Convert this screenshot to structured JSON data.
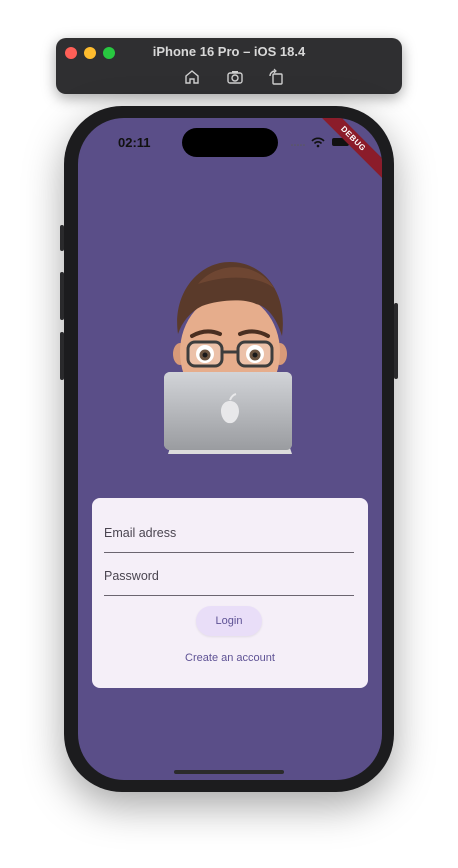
{
  "simulator": {
    "title": "iPhone 16 Pro – iOS 18.4",
    "tools": [
      "home-icon",
      "screenshot-icon",
      "rotate-icon"
    ]
  },
  "status_bar": {
    "time": "02:11",
    "debug_banner": "DEBUG"
  },
  "login": {
    "email_placeholder": "Email adress",
    "password_placeholder": "Password",
    "login_label": "Login",
    "create_account_label": "Create an account"
  },
  "colors": {
    "background": "#5a4e88",
    "card": "#f5eff8",
    "button": "#e9def8",
    "accent": "#5e5295"
  }
}
